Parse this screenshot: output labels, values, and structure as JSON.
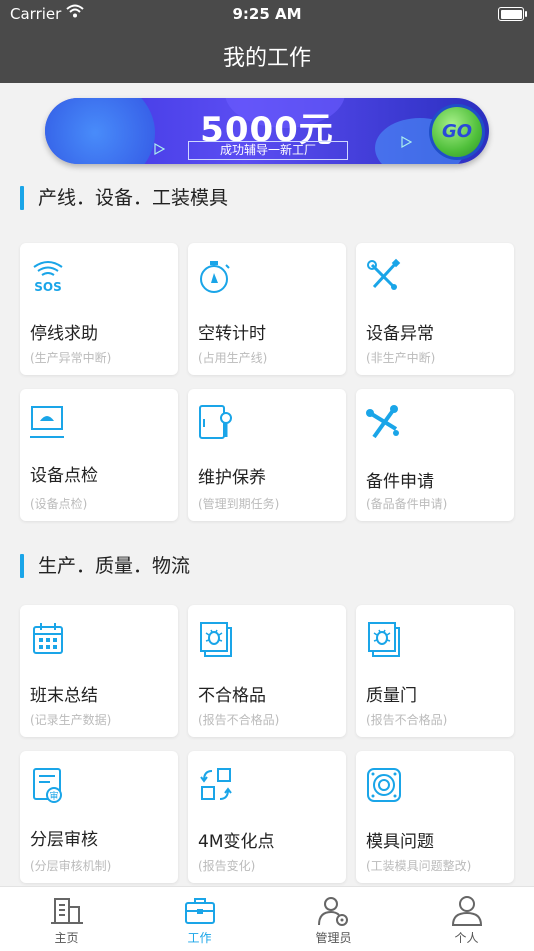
{
  "status_bar": {
    "carrier": "Carrier",
    "time": "9:25 AM"
  },
  "header": {
    "title": "我的工作"
  },
  "banner": {
    "amount": "5000元",
    "subtitle": "成功辅导一新工厂",
    "go_label": "GO"
  },
  "sections": [
    {
      "title": "产线．设备．工装模具",
      "items": [
        {
          "name": "停线求助",
          "desc": "(生产异常中断)",
          "icon": "sos-icon"
        },
        {
          "name": "空转计时",
          "desc": "(占用生产线)",
          "icon": "stopwatch-icon"
        },
        {
          "name": "设备异常",
          "desc": "(非生产中断)",
          "icon": "tools-icon"
        },
        {
          "name": "设备点检",
          "desc": "(设备点检)",
          "icon": "monitor-check-icon"
        },
        {
          "name": "维护保养",
          "desc": "(管理到期任务)",
          "icon": "cabinet-wrench-icon"
        },
        {
          "name": "备件申请",
          "desc": "(备品备件申请)",
          "icon": "bolts-icon"
        }
      ]
    },
    {
      "title": "生产．质量．物流",
      "items": [
        {
          "name": "班末总结",
          "desc": "(记录生产数据)",
          "icon": "calendar-icon"
        },
        {
          "name": "不合格品",
          "desc": "(报告不合格品)",
          "icon": "bug-report-icon"
        },
        {
          "name": "质量门",
          "desc": "(报告不合格品)",
          "icon": "bug-report-icon"
        },
        {
          "name": "分层审核",
          "desc": "(分层审核机制)",
          "icon": "audit-doc-icon"
        },
        {
          "name": "4M变化点",
          "desc": "(报告变化)",
          "icon": "change-arrows-icon"
        },
        {
          "name": "模具问题",
          "desc": "(工装模具问题整改)",
          "icon": "speaker-mold-icon"
        }
      ]
    }
  ],
  "tabbar": {
    "items": [
      {
        "label": "主页",
        "icon": "building-icon"
      },
      {
        "label": "工作",
        "icon": "briefcase-icon"
      },
      {
        "label": "管理员",
        "icon": "admin-gear-icon"
      },
      {
        "label": "个人",
        "icon": "person-icon"
      }
    ],
    "active_index": 1
  },
  "colors": {
    "accent": "#1aa5e8",
    "header_bg": "#4a4a4a",
    "page_bg": "#f2f2f2"
  }
}
